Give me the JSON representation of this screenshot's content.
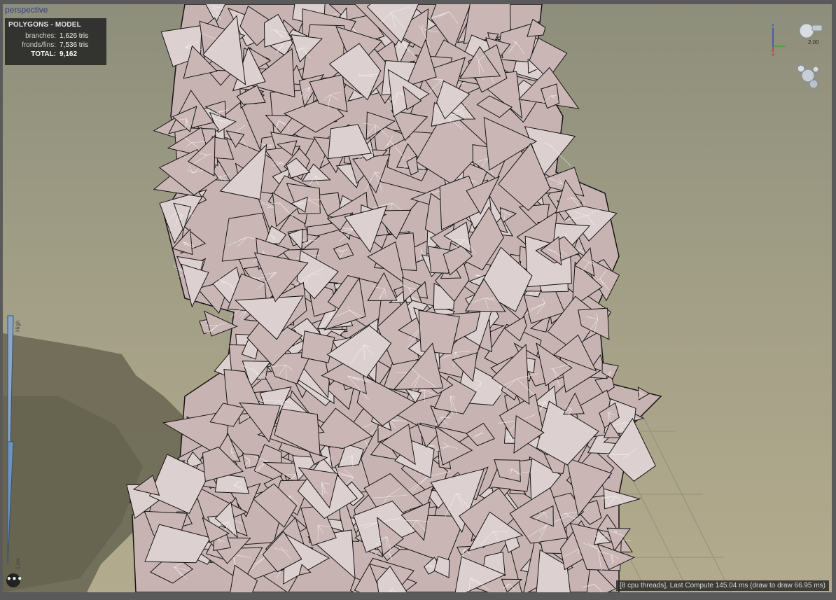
{
  "viewport": {
    "title": "perspective"
  },
  "stats": {
    "header": "POLYGONS - MODEL",
    "rows": [
      {
        "label": "branches:",
        "value": "1,626 tris"
      },
      {
        "label": "fronds/fins:",
        "value": "7,536 tris"
      },
      {
        "label": "TOTAL:",
        "value": "9,162"
      }
    ]
  },
  "lod": {
    "high_label": "High",
    "low_label": "Low"
  },
  "zoom": {
    "label": "2.00"
  },
  "axes": {
    "z": "z",
    "x": "x"
  },
  "status": {
    "text": "[8 cpu threads], Last Compute 145.04 ms (draw to draw 66.95 ms)"
  },
  "more_button": {
    "label": "•••"
  },
  "colors": {
    "leaf_fill": "#c9b6b5",
    "leaf_stroke": "#151515",
    "highlight": "#f4f0f0",
    "ground": "#6f6b57"
  }
}
